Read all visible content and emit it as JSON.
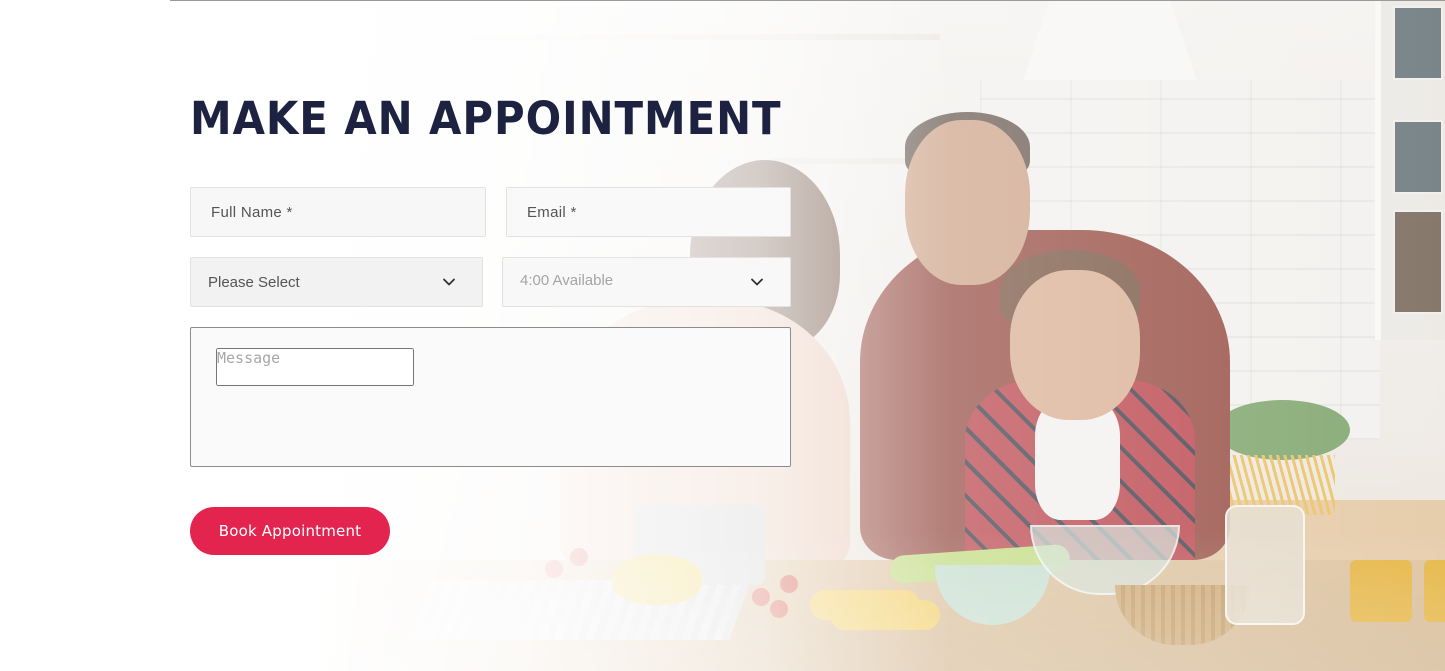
{
  "heading": "MAKE AN APPOINTMENT",
  "form": {
    "full_name": {
      "placeholder": "Full Name *",
      "value": ""
    },
    "email": {
      "placeholder": "Email *",
      "value": ""
    },
    "service_select": {
      "selected": "Please Select",
      "icon": "chevron-down-icon"
    },
    "time_select": {
      "selected": "4:00 Available",
      "icon": "chevron-down-icon"
    },
    "message": {
      "placeholder": "Message",
      "value": ""
    },
    "submit_label": "Book Appointment"
  },
  "background_image": {
    "description": "family cooking together in a bright kitchen"
  },
  "colors": {
    "heading": "#1d2240",
    "button": "#e3244f",
    "button_text": "#ffffff"
  }
}
